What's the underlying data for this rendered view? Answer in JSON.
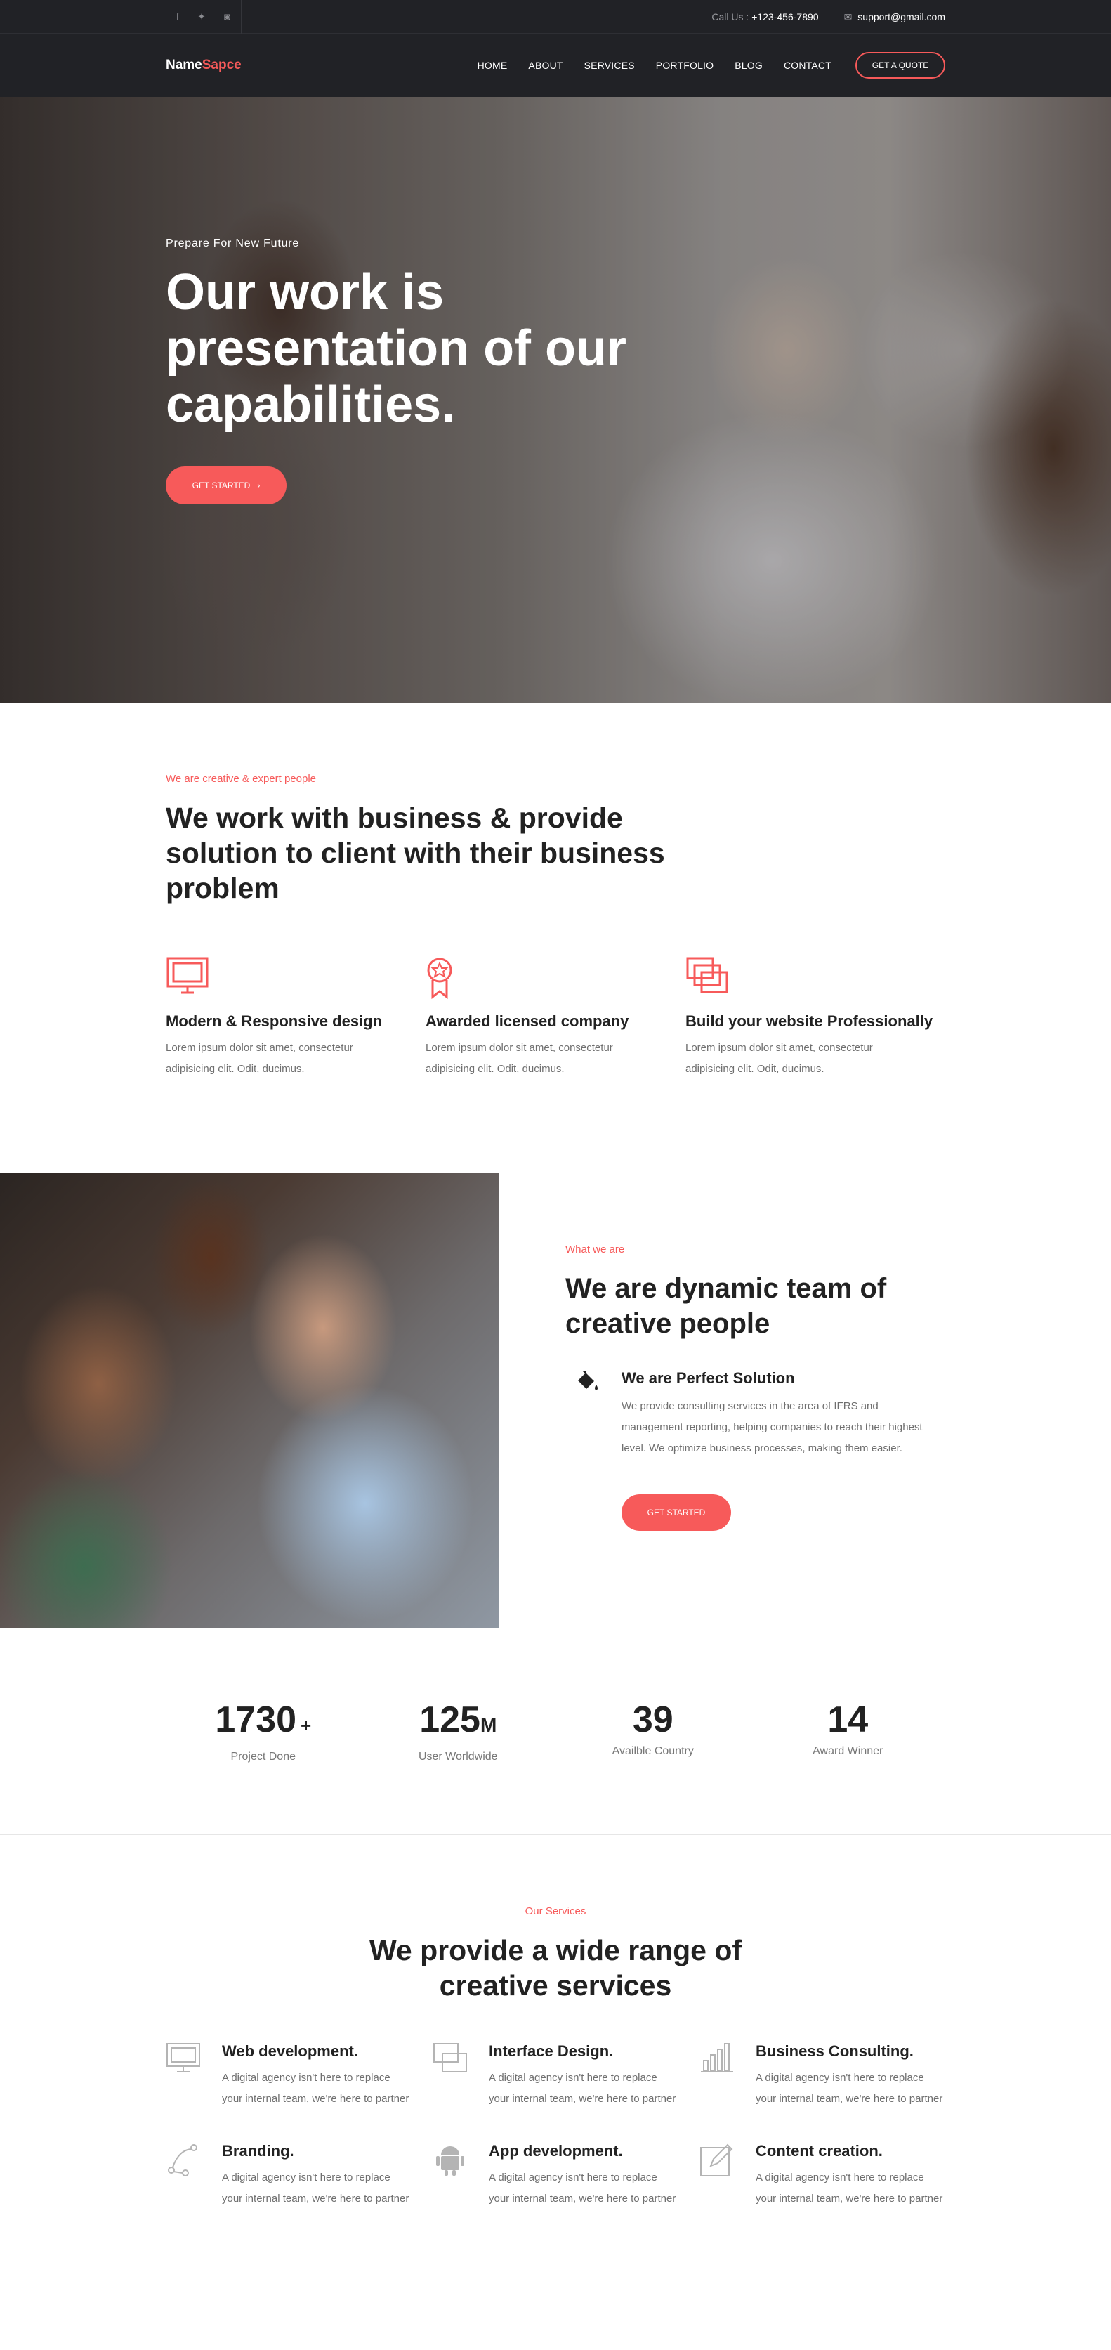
{
  "topbar": {
    "socials": [
      {
        "icon": "facebook-icon",
        "glyph": "f"
      },
      {
        "icon": "twitter-icon",
        "glyph": "🐦"
      },
      {
        "icon": "github-icon",
        "glyph": "◙"
      }
    ],
    "call_label": "Call Us :",
    "phone": "+123-456-7890",
    "email": "support@gmail.com"
  },
  "nav": {
    "brand_main": "Name",
    "brand_accent": "Sapce",
    "items": [
      "HOME",
      "ABOUT",
      "SERVICES",
      "PORTFOLIO",
      "BLOG",
      "CONTACT"
    ],
    "quote_label": "GET A QUOTE"
  },
  "hero": {
    "eyebrow": "Prepare For New Future",
    "title": "Our work is presentation of our capabilities.",
    "cta_label": "GET STARTED",
    "cta_icon": "›"
  },
  "features": {
    "tag": "We are creative & expert people",
    "title": "We work with business & provide solution to client with their business problem",
    "items": [
      {
        "icon": "monitor-icon",
        "glyph": "▭",
        "title": "Modern & Responsive design",
        "text": "Lorem ipsum dolor sit amet, consectetur adipisicing elit. Odit, ducimus."
      },
      {
        "icon": "award-icon",
        "glyph": "✪",
        "title": "Awarded licensed company",
        "text": "Lorem ipsum dolor sit amet, consectetur adipisicing elit. Odit, ducimus."
      },
      {
        "icon": "windows-icon",
        "glyph": "⧉",
        "title": "Build your website Professionally",
        "text": "Lorem ipsum dolor sit amet, consectetur adipisicing elit. Odit, ducimus."
      }
    ]
  },
  "team": {
    "tag": "What we are",
    "title": "We are dynamic team of creative people",
    "solution_icon": "paint-bucket-icon",
    "solution_glyph": "🪣",
    "solution_title": "We are Perfect Solution",
    "solution_text": "We provide consulting services in the area of IFRS and management reporting, helping companies to reach their highest level. We optimize business processes, making them easier.",
    "cta_label": "GET STARTED"
  },
  "stats": [
    {
      "value": "1730",
      "suffix": "+",
      "label": "Project Done"
    },
    {
      "value": "125",
      "suffix": "M",
      "label": "User Worldwide"
    },
    {
      "value": "39",
      "suffix": "",
      "label": "Availble Country"
    },
    {
      "value": "14",
      "suffix": "",
      "label": "Award Winner"
    }
  ],
  "services": {
    "tag": "Our Services",
    "title": "We provide a wide range of creative services",
    "items": [
      {
        "icon": "desktop-icon",
        "glyph": "▭",
        "title": "Web development.",
        "text": "A digital agency isn't here to replace your internal team, we're here to partner"
      },
      {
        "icon": "layers-icon",
        "glyph": "⧉",
        "title": "Interface Design.",
        "text": "A digital agency isn't here to replace your internal team, we're here to partner"
      },
      {
        "icon": "bar-chart-icon",
        "glyph": "▥",
        "title": "Business Consulting.",
        "text": "A digital agency isn't here to replace your internal team, we're here to partner"
      },
      {
        "icon": "vector-pen-icon",
        "glyph": "✎",
        "title": "Branding.",
        "text": "A digital agency isn't here to replace your internal team, we're here to partner"
      },
      {
        "icon": "android-icon",
        "glyph": "☗",
        "title": "App development.",
        "text": "A digital agency isn't here to replace your internal team, we're here to partner"
      },
      {
        "icon": "edit-icon",
        "glyph": "✍",
        "title": "Content creation.",
        "text": "A digital agency isn't here to replace your internal team, we're here to partner"
      }
    ]
  },
  "colors": {
    "accent": "#f75a5a",
    "dark": "#212226",
    "text": "#222222",
    "muted": "#6f6f6f"
  }
}
